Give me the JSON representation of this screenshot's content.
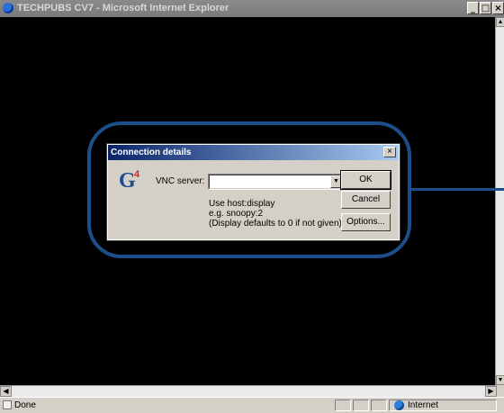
{
  "window": {
    "title": "TECHPUBS CV7 - Microsoft Internet Explorer",
    "minimize": "_",
    "maximize": "□",
    "close": "×"
  },
  "dialog": {
    "title": "Connection details",
    "close": "×",
    "logo_text": "G",
    "logo_sup": "4",
    "vnc_label": "VNC server:",
    "vnc_value": "",
    "hint_lines": [
      "Use host:display",
      "e.g. snoopy:2",
      "(Display defaults to 0 if not given)"
    ],
    "ok_label": "OK",
    "cancel_label": "Cancel",
    "options_label": "Options..."
  },
  "scroll_arrows": {
    "up": "▲",
    "down": "▼",
    "left": "◀",
    "right": "▶",
    "combo": "▼"
  },
  "statusbar": {
    "status": "Done",
    "zone": "Internet"
  },
  "colors": {
    "callout": "#1c4f8a",
    "dialog_title_start": "#0a246a",
    "dialog_title_end": "#a6caf0",
    "logo": "#1a4c8f",
    "logo_accent": "#d22"
  },
  "icons": {
    "title": "ie-icon",
    "status": "page-icon",
    "zone": "globe-icon"
  }
}
